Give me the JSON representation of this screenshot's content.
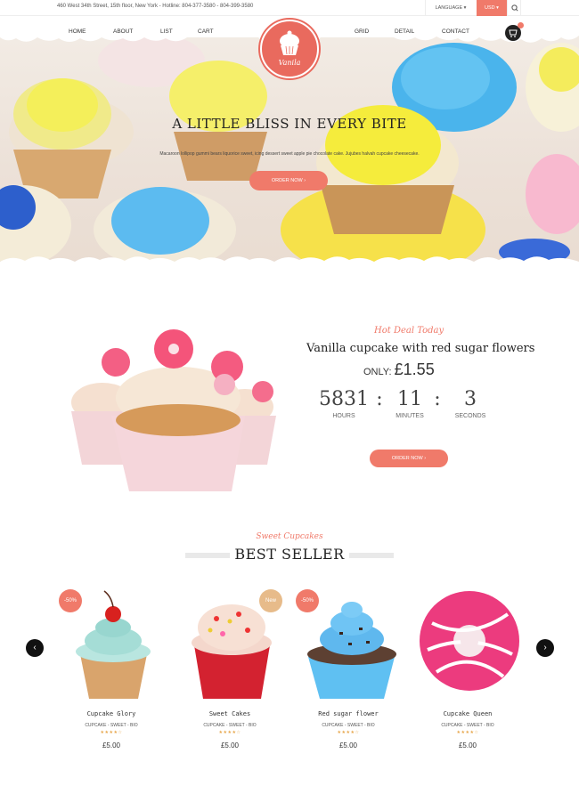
{
  "topbar": {
    "info": "460 West 34th Street, 15th floor, New York - Hotline: 804-377-3580 - 804-399-3580",
    "language": "LANGUAGE ▾",
    "currency": "USD ▾"
  },
  "nav": {
    "left": [
      "HOME",
      "ABOUT",
      "LIST",
      "CART"
    ],
    "right": [
      "GRID",
      "DETAIL",
      "CONTACT"
    ],
    "logo_text": "Vanila"
  },
  "hero": {
    "title": "A LITTLE BLISS IN EVERY BITE",
    "subtitle": "Macaroon lollipop gummi bears liquorice sweet, icing dessert sweet apple pie chocolate cake. Jujubes halvah cupcake cheesecake.",
    "button": "ORDER NOW  ›"
  },
  "deal": {
    "script_title": "Hot Deal Today",
    "product": "Vanilla cupcake with red sugar flowers",
    "only_label": "ONLY:",
    "price": "£1.55",
    "countdown": {
      "hours": "5831",
      "minutes": "11",
      "seconds": "3",
      "hours_label": "HOURS",
      "minutes_label": "MINUTES",
      "seconds_label": "SECONDS",
      "sep": ":"
    },
    "button": "ORDER NOW  ›"
  },
  "bestseller": {
    "script_title": "Sweet Cupcakes",
    "title": "BEST SELLER",
    "prev": "‹",
    "next": "›",
    "products": [
      {
        "name": "Cupcake Glory",
        "tags": "CUPCAKE - SWEET - BIO",
        "stars": "★★★★☆",
        "price": "£5.00",
        "badge": "-50%"
      },
      {
        "name": "Sweet Cakes",
        "tags": "CUPCAKE - SWEET - BIO",
        "stars": "★★★★☆",
        "price": "£5.00",
        "badge": "New"
      },
      {
        "name": "Red sugar flower",
        "tags": "CUPCAKE - SWEET - BIO",
        "stars": "★★★★☆",
        "price": "£5.00",
        "badge": "-50%"
      },
      {
        "name": "Cupcake Queen",
        "tags": "CUPCAKE - SWEET - BIO",
        "stars": "★★★★☆",
        "price": "£5.00",
        "badge": ""
      }
    ]
  },
  "colors": {
    "accent": "#f07a6a",
    "new_badge": "#e7bb8a"
  },
  "icons": [
    "search-icon",
    "cart-icon",
    "cupcake-logo-icon",
    "chevron-left-icon",
    "chevron-right-icon"
  ]
}
